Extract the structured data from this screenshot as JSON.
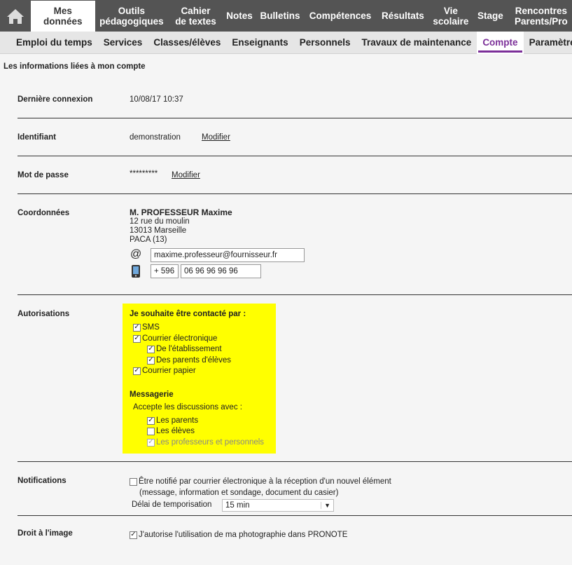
{
  "topnav": {
    "items": [
      "Mes données",
      "Outils\npédagogiques",
      "Cahier\nde textes",
      "Notes",
      "Bulletins",
      "Compétences",
      "Résultats",
      "Vie\nscolaire",
      "Stage",
      "Rencontres\nParents/Pro"
    ]
  },
  "subnav": {
    "items": [
      "Emploi du temps",
      "Services",
      "Classes/élèves",
      "Enseignants",
      "Personnels",
      "Travaux de maintenance",
      "Compte",
      "Paramètres"
    ]
  },
  "page": {
    "title": "Les informations liées à mon compte"
  },
  "rows": {
    "last_login_label": "Dernière connexion",
    "last_login_value": "10/08/17 10:37",
    "login_label": "Identifiant",
    "login_value": "demonstration",
    "login_modify": "Modifier",
    "password_label": "Mot de passe",
    "password_value": "*********",
    "password_modify": "Modifier",
    "contact_label": "Coordonnées",
    "contact_name": "M. PROFESSEUR Maxime",
    "address_line1": "12 rue du moulin",
    "address_line2": "13013 Marseille",
    "address_line3": "PACA (13)",
    "email": "maxime.professeur@fournisseur.fr",
    "phone_prefix": "+ 596",
    "phone_number": "06 96 96 96 96",
    "auth_label": "Autorisations",
    "notif_label": "Notifications",
    "image_label": "Droit à l'image"
  },
  "authorizations": {
    "contact_title": "Je souhaite être contacté par :",
    "sms": "SMS",
    "email": "Courrier électronique",
    "from_school": "De l'établissement",
    "from_parents": "Des parents d'élèves",
    "paper": "Courrier papier",
    "messaging_title": "Messagerie",
    "accept_text": "Accepte les discussions avec :",
    "parents": "Les parents",
    "students": "Les élèves",
    "teachers": "Les professeurs et personnels"
  },
  "notifications": {
    "text_line1": "Être notifié par courrier électronique à la réception d'un nouvel élément",
    "text_line2": "(message, information et sondage, document du casier)",
    "delay_label": "Délai de temporisation",
    "delay_value": "15 min"
  },
  "image_rights": {
    "text": "J'autorise l'utilisation de ma photographie dans PRONOTE"
  }
}
